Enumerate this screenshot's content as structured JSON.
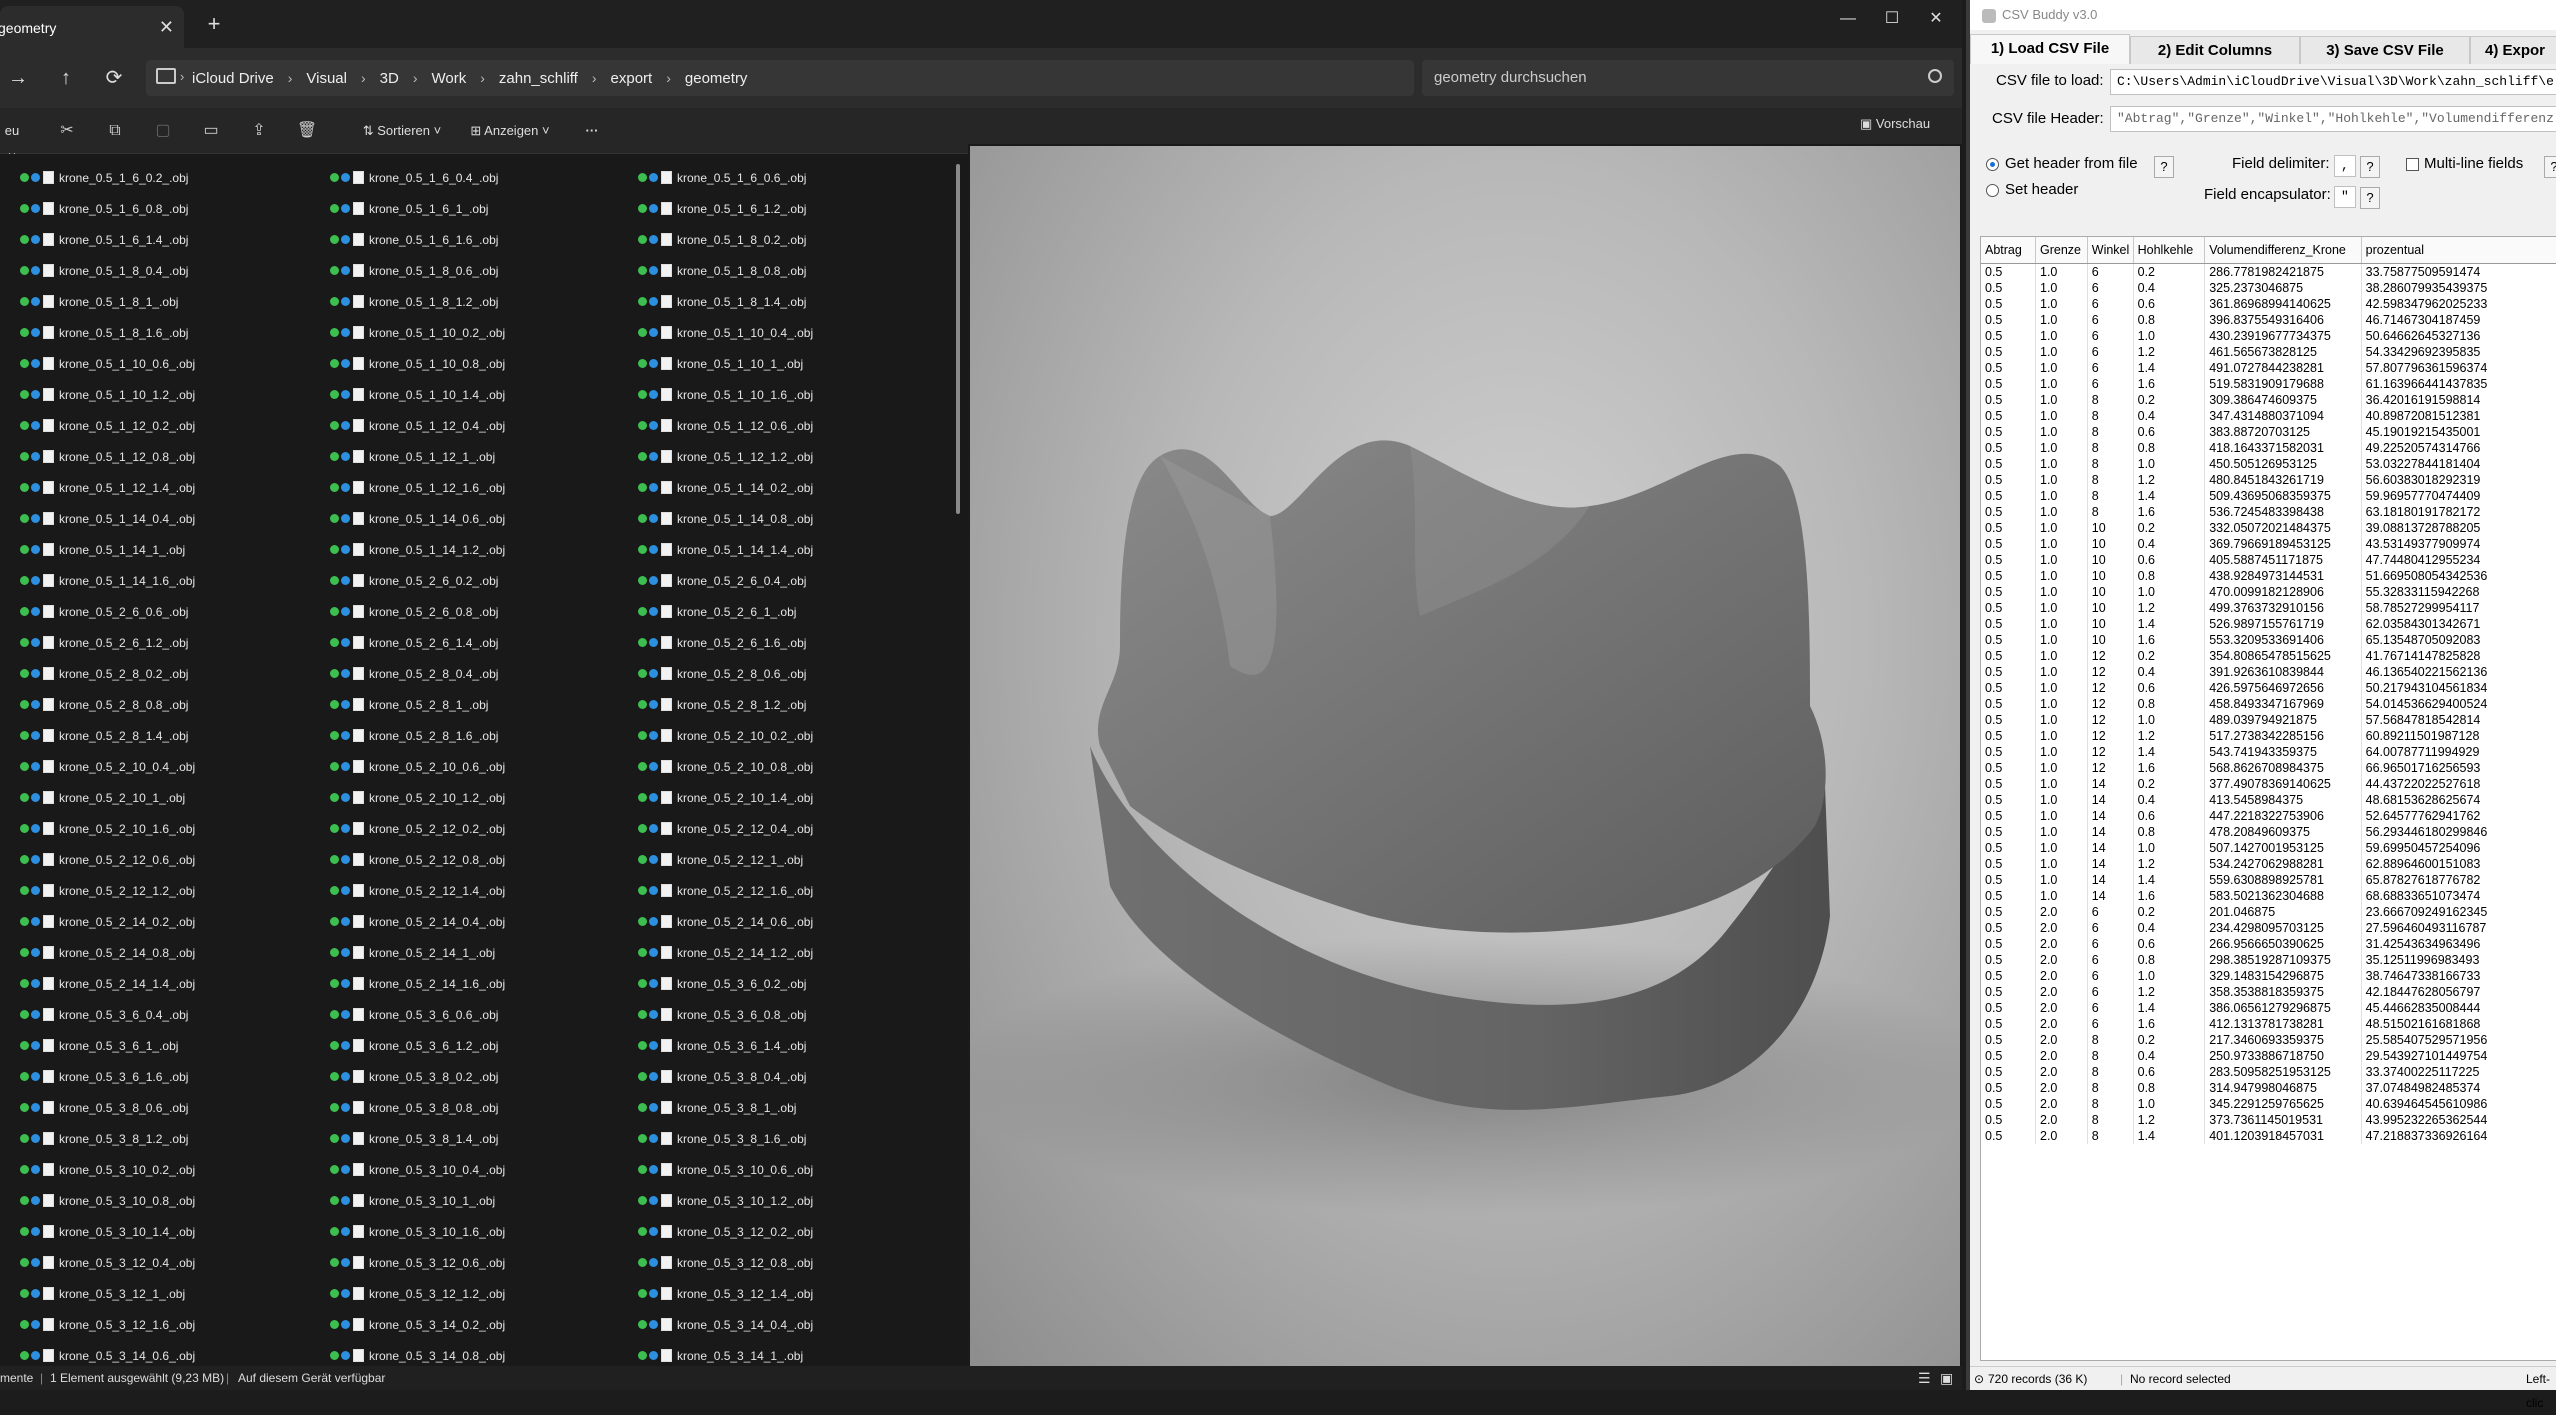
{
  "explorer": {
    "tab_title": "geometry",
    "breadcrumb": [
      "iCloud Drive",
      "Visual",
      "3D",
      "Work",
      "zahn_schliff",
      "export",
      "geometry"
    ],
    "search_placeholder": "geometry durchsuchen",
    "toolbar": {
      "new_label": "eu",
      "sort_label": "Sortieren",
      "view_label": "Anzeigen",
      "more_label": "···",
      "preview_label": "Vorschau"
    },
    "status": {
      "left": "mente",
      "selected": "1 Element ausgewählt (9,23 MB)",
      "availability": "Auf diesem Gerät verfügbar"
    },
    "files": {
      "col1": [
        "krone_0.5_1_6_0.2_.obj",
        "krone_0.5_1_6_0.8_.obj",
        "krone_0.5_1_6_1.4_.obj",
        "krone_0.5_1_8_0.4_.obj",
        "krone_0.5_1_8_1_.obj",
        "krone_0.5_1_8_1.6_.obj",
        "krone_0.5_1_10_0.6_.obj",
        "krone_0.5_1_10_1.2_.obj",
        "krone_0.5_1_12_0.2_.obj",
        "krone_0.5_1_12_0.8_.obj",
        "krone_0.5_1_12_1.4_.obj",
        "krone_0.5_1_14_0.4_.obj",
        "krone_0.5_1_14_1_.obj",
        "krone_0.5_1_14_1.6_.obj",
        "krone_0.5_2_6_0.6_.obj",
        "krone_0.5_2_6_1.2_.obj",
        "krone_0.5_2_8_0.2_.obj",
        "krone_0.5_2_8_0.8_.obj",
        "krone_0.5_2_8_1.4_.obj",
        "krone_0.5_2_10_0.4_.obj",
        "krone_0.5_2_10_1_.obj",
        "krone_0.5_2_10_1.6_.obj",
        "krone_0.5_2_12_0.6_.obj",
        "krone_0.5_2_12_1.2_.obj",
        "krone_0.5_2_14_0.2_.obj",
        "krone_0.5_2_14_0.8_.obj",
        "krone_0.5_2_14_1.4_.obj",
        "krone_0.5_3_6_0.4_.obj",
        "krone_0.5_3_6_1_.obj",
        "krone_0.5_3_6_1.6_.obj",
        "krone_0.5_3_8_0.6_.obj",
        "krone_0.5_3_8_1.2_.obj",
        "krone_0.5_3_10_0.2_.obj",
        "krone_0.5_3_10_0.8_.obj",
        "krone_0.5_3_10_1.4_.obj",
        "krone_0.5_3_12_0.4_.obj",
        "krone_0.5_3_12_1_.obj",
        "krone_0.5_3_12_1.6_.obj",
        "krone_0.5_3_14_0.6_.obj"
      ],
      "col2": [
        "krone_0.5_1_6_0.4_.obj",
        "krone_0.5_1_6_1_.obj",
        "krone_0.5_1_6_1.6_.obj",
        "krone_0.5_1_8_0.6_.obj",
        "krone_0.5_1_8_1.2_.obj",
        "krone_0.5_1_10_0.2_.obj",
        "krone_0.5_1_10_0.8_.obj",
        "krone_0.5_1_10_1.4_.obj",
        "krone_0.5_1_12_0.4_.obj",
        "krone_0.5_1_12_1_.obj",
        "krone_0.5_1_12_1.6_.obj",
        "krone_0.5_1_14_0.6_.obj",
        "krone_0.5_1_14_1.2_.obj",
        "krone_0.5_2_6_0.2_.obj",
        "krone_0.5_2_6_0.8_.obj",
        "krone_0.5_2_6_1.4_.obj",
        "krone_0.5_2_8_0.4_.obj",
        "krone_0.5_2_8_1_.obj",
        "krone_0.5_2_8_1.6_.obj",
        "krone_0.5_2_10_0.6_.obj",
        "krone_0.5_2_10_1.2_.obj",
        "krone_0.5_2_12_0.2_.obj",
        "krone_0.5_2_12_0.8_.obj",
        "krone_0.5_2_12_1.4_.obj",
        "krone_0.5_2_14_0.4_.obj",
        "krone_0.5_2_14_1_.obj",
        "krone_0.5_2_14_1.6_.obj",
        "krone_0.5_3_6_0.6_.obj",
        "krone_0.5_3_6_1.2_.obj",
        "krone_0.5_3_8_0.2_.obj",
        "krone_0.5_3_8_0.8_.obj",
        "krone_0.5_3_8_1.4_.obj",
        "krone_0.5_3_10_0.4_.obj",
        "krone_0.5_3_10_1_.obj",
        "krone_0.5_3_10_1.6_.obj",
        "krone_0.5_3_12_0.6_.obj",
        "krone_0.5_3_12_1.2_.obj",
        "krone_0.5_3_14_0.2_.obj",
        "krone_0.5_3_14_0.8_.obj"
      ],
      "col3": [
        "krone_0.5_1_6_0.6_.obj",
        "krone_0.5_1_6_1.2_.obj",
        "krone_0.5_1_8_0.2_.obj",
        "krone_0.5_1_8_0.8_.obj",
        "krone_0.5_1_8_1.4_.obj",
        "krone_0.5_1_10_0.4_.obj",
        "krone_0.5_1_10_1_.obj",
        "krone_0.5_1_10_1.6_.obj",
        "krone_0.5_1_12_0.6_.obj",
        "krone_0.5_1_12_1.2_.obj",
        "krone_0.5_1_14_0.2_.obj",
        "krone_0.5_1_14_0.8_.obj",
        "krone_0.5_1_14_1.4_.obj",
        "krone_0.5_2_6_0.4_.obj",
        "krone_0.5_2_6_1_.obj",
        "krone_0.5_2_6_1.6_.obj",
        "krone_0.5_2_8_0.6_.obj",
        "krone_0.5_2_8_1.2_.obj",
        "krone_0.5_2_10_0.2_.obj",
        "krone_0.5_2_10_0.8_.obj",
        "krone_0.5_2_10_1.4_.obj",
        "krone_0.5_2_12_0.4_.obj",
        "krone_0.5_2_12_1_.obj",
        "krone_0.5_2_12_1.6_.obj",
        "krone_0.5_2_14_0.6_.obj",
        "krone_0.5_2_14_1.2_.obj",
        "krone_0.5_3_6_0.2_.obj",
        "krone_0.5_3_6_0.8_.obj",
        "krone_0.5_3_6_1.4_.obj",
        "krone_0.5_3_8_0.4_.obj",
        "krone_0.5_3_8_1_.obj",
        "krone_0.5_3_8_1.6_.obj",
        "krone_0.5_3_10_0.6_.obj",
        "krone_0.5_3_10_1.2_.obj",
        "krone_0.5_3_12_0.2_.obj",
        "krone_0.5_3_12_0.8_.obj",
        "krone_0.5_3_12_1.4_.obj",
        "krone_0.5_3_14_0.4_.obj",
        "krone_0.5_3_14_1_.obj"
      ]
    }
  },
  "csv": {
    "title": "CSV Buddy v3.0",
    "tabs": [
      "1) Load CSV File",
      "2) Edit Columns",
      "3) Save CSV File",
      "4) Expor"
    ],
    "file_label": "CSV file to load:",
    "file_value": "C:\\Users\\Admin\\iCloudDrive\\Visual\\3D\\Work\\zahn_schliff\\e",
    "header_label": "CSV file Header:",
    "header_value": "\"Abtrag\",\"Grenze\",\"Winkel\",\"Hohlkehle\",\"Volumendifferenz",
    "get_header": "Get header from  file",
    "set_header": "Set header",
    "field_delimiter": "Field delimiter:",
    "delimiter_value": ",",
    "field_encapsulator": "Field encapsulator:",
    "encapsulator_value": "\"",
    "multiline": "Multi-line fields",
    "q": "?",
    "columns": [
      "Abtrag",
      "Grenze",
      "Winkel",
      "Hohlkehle",
      "Volumendifferenz_Krone",
      "prozentual"
    ],
    "rows": [
      [
        "0.5",
        "1.0",
        "6",
        "0.2",
        "286.7781982421875",
        "33.75877509591474"
      ],
      [
        "0.5",
        "1.0",
        "6",
        "0.4",
        "325.2373046875",
        "38.286079935439375"
      ],
      [
        "0.5",
        "1.0",
        "6",
        "0.6",
        "361.86968994140625",
        "42.598347962025233"
      ],
      [
        "0.5",
        "1.0",
        "6",
        "0.8",
        "396.8375549316406",
        "46.71467304187459"
      ],
      [
        "0.5",
        "1.0",
        "6",
        "1.0",
        "430.23919677734375",
        "50.64662645327136"
      ],
      [
        "0.5",
        "1.0",
        "6",
        "1.2",
        "461.565673828125",
        "54.33429692395835"
      ],
      [
        "0.5",
        "1.0",
        "6",
        "1.4",
        "491.0727844238281",
        "57.80779636159637​4"
      ],
      [
        "0.5",
        "1.0",
        "6",
        "1.6",
        "519.5831909179688",
        "61.16396644143783​5"
      ],
      [
        "0.5",
        "1.0",
        "8",
        "0.2",
        "309.386474609375",
        "36.42016191598814"
      ],
      [
        "0.5",
        "1.0",
        "8",
        "0.4",
        "347.4314880371094",
        "40.89872081512381"
      ],
      [
        "0.5",
        "1.0",
        "8",
        "0.6",
        "383.88720703125",
        "45.19019215435001"
      ],
      [
        "0.5",
        "1.0",
        "8",
        "0.8",
        "418.1643371582031",
        "49.22520574314766"
      ],
      [
        "0.5",
        "1.0",
        "8",
        "1.0",
        "450.505126953125",
        "53.03227844181404"
      ],
      [
        "0.5",
        "1.0",
        "8",
        "1.2",
        "480.8451843261719",
        "56.60383018292319"
      ],
      [
        "0.5",
        "1.0",
        "8",
        "1.4",
        "509.4369506835937​5",
        "59.96957770474409"
      ],
      [
        "0.5",
        "1.0",
        "8",
        "1.6",
        "536.7245483398438",
        "63.18180191782172"
      ],
      [
        "0.5",
        "1.0",
        "10",
        "0.2",
        "332.05072021484375",
        "39.08813728788205"
      ],
      [
        "0.5",
        "1.0",
        "10",
        "0.4",
        "369.79669189453125",
        "43.53149377909974"
      ],
      [
        "0.5",
        "1.0",
        "10",
        "0.6",
        "405.5887451171875",
        "47.74480412955234"
      ],
      [
        "0.5",
        "1.0",
        "10",
        "0.8",
        "438.9284973144531",
        "51.66950805434253​6"
      ],
      [
        "0.5",
        "1.0",
        "10",
        "1.0",
        "470.0099182128906",
        "55.32833115942268"
      ],
      [
        "0.5",
        "1.0",
        "10",
        "1.2",
        "499.3763732910156",
        "58.78527299954117"
      ],
      [
        "0.5",
        "1.0",
        "10",
        "1.4",
        "526.9897155761719",
        "62.03584301342671"
      ],
      [
        "0.5",
        "1.0",
        "10",
        "1.6",
        "553.3209533691406",
        "65.13548705092083"
      ],
      [
        "0.5",
        "1.0",
        "12",
        "0.2",
        "354.8086547851562​5",
        "41.76714147825828"
      ],
      [
        "0.5",
        "1.0",
        "12",
        "0.4",
        "391.9263610839844",
        "46.13654022156213​6"
      ],
      [
        "0.5",
        "1.0",
        "12",
        "0.6",
        "426.5975646972656",
        "50.21794310456183​4"
      ],
      [
        "0.5",
        "1.0",
        "12",
        "0.8",
        "458.8493347167969",
        "54.01453662940052​4"
      ],
      [
        "0.5",
        "1.0",
        "12",
        "1.0",
        "489.039794921875",
        "57.56847818542814"
      ],
      [
        "0.5",
        "1.0",
        "12",
        "1.2",
        "517.2738342285156",
        "60.89211501987128"
      ],
      [
        "0.5",
        "1.0",
        "12",
        "1.4",
        "543.741943359375",
        "64.00787711994929"
      ],
      [
        "0.5",
        "1.0",
        "12",
        "1.6",
        "568.8626708984375",
        "66.96501716256593"
      ],
      [
        "0.5",
        "1.0",
        "14",
        "0.2",
        "377.49078369140625",
        "44.43722022527618"
      ],
      [
        "0.5",
        "1.0",
        "14",
        "0.4",
        "413.5458984375",
        "48.68153628625674"
      ],
      [
        "0.5",
        "1.0",
        "14",
        "0.6",
        "447.2218322753906",
        "52.64577762941762"
      ],
      [
        "0.5",
        "1.0",
        "14",
        "0.8",
        "478.20849609375",
        "56.29344618029984​6"
      ],
      [
        "0.5",
        "1.0",
        "14",
        "1.0",
        "507.1427001953125",
        "59.69950457254096"
      ],
      [
        "0.5",
        "1.0",
        "14",
        "1.2",
        "534.2427062988281",
        "62.88964600151083"
      ],
      [
        "0.5",
        "1.0",
        "14",
        "1.4",
        "559.6308898925781",
        "65.87827618776782"
      ],
      [
        "0.5",
        "1.0",
        "14",
        "1.6",
        "583.5021362304688",
        "68.68833651073474"
      ],
      [
        "0.5",
        "2.0",
        "6",
        "0.2",
        "201.046875",
        "23.66670924916234​5"
      ],
      [
        "0.5",
        "2.0",
        "6",
        "0.4",
        "234.42980957031​25",
        "27.59646049311678​7"
      ],
      [
        "0.5",
        "2.0",
        "6",
        "0.6",
        "266.9566650390625",
        "31.42543634963496"
      ],
      [
        "0.5",
        "2.0",
        "6",
        "0.8",
        "298.3851928710937​5",
        "35.12511996983493"
      ],
      [
        "0.5",
        "2.0",
        "6",
        "1.0",
        "329.1483154296875",
        "38.74647338166733"
      ],
      [
        "0.5",
        "2.0",
        "6",
        "1.2",
        "358.3538818359375",
        "42.18447628056797"
      ],
      [
        "0.5",
        "2.0",
        "6",
        "1.4",
        "386.06561279296875",
        "45.44662835008444"
      ],
      [
        "0.5",
        "2.0",
        "6",
        "1.6",
        "412.1313781738281",
        "48.51502161681868"
      ],
      [
        "0.5",
        "2.0",
        "8",
        "0.2",
        "217.3460693359375",
        "25.58540752957195​6"
      ],
      [
        "0.5",
        "2.0",
        "8",
        "0.4",
        "250.9733886718750",
        "29.54392710144975​4"
      ],
      [
        "0.5",
        "2.0",
        "8",
        "0.6",
        "283.50958251953125",
        "33.37400225117225"
      ],
      [
        "0.5",
        "2.0",
        "8",
        "0.8",
        "314.947998046875",
        "37.07484982485374"
      ],
      [
        "0.5",
        "2.0",
        "8",
        "1.0",
        "345.2291259765625",
        "40.63946454561098​6"
      ],
      [
        "0.5",
        "2.0",
        "8",
        "1.2",
        "373.7361145019531",
        "43.99523226536254​4"
      ],
      [
        "0.5",
        "2.0",
        "8",
        "1.4",
        "401.1203918457031",
        "47.21883733692616​4"
      ]
    ],
    "status_records": "720 records (36 K)",
    "status_selected": "No record selected",
    "status_right": "Left-clic"
  }
}
